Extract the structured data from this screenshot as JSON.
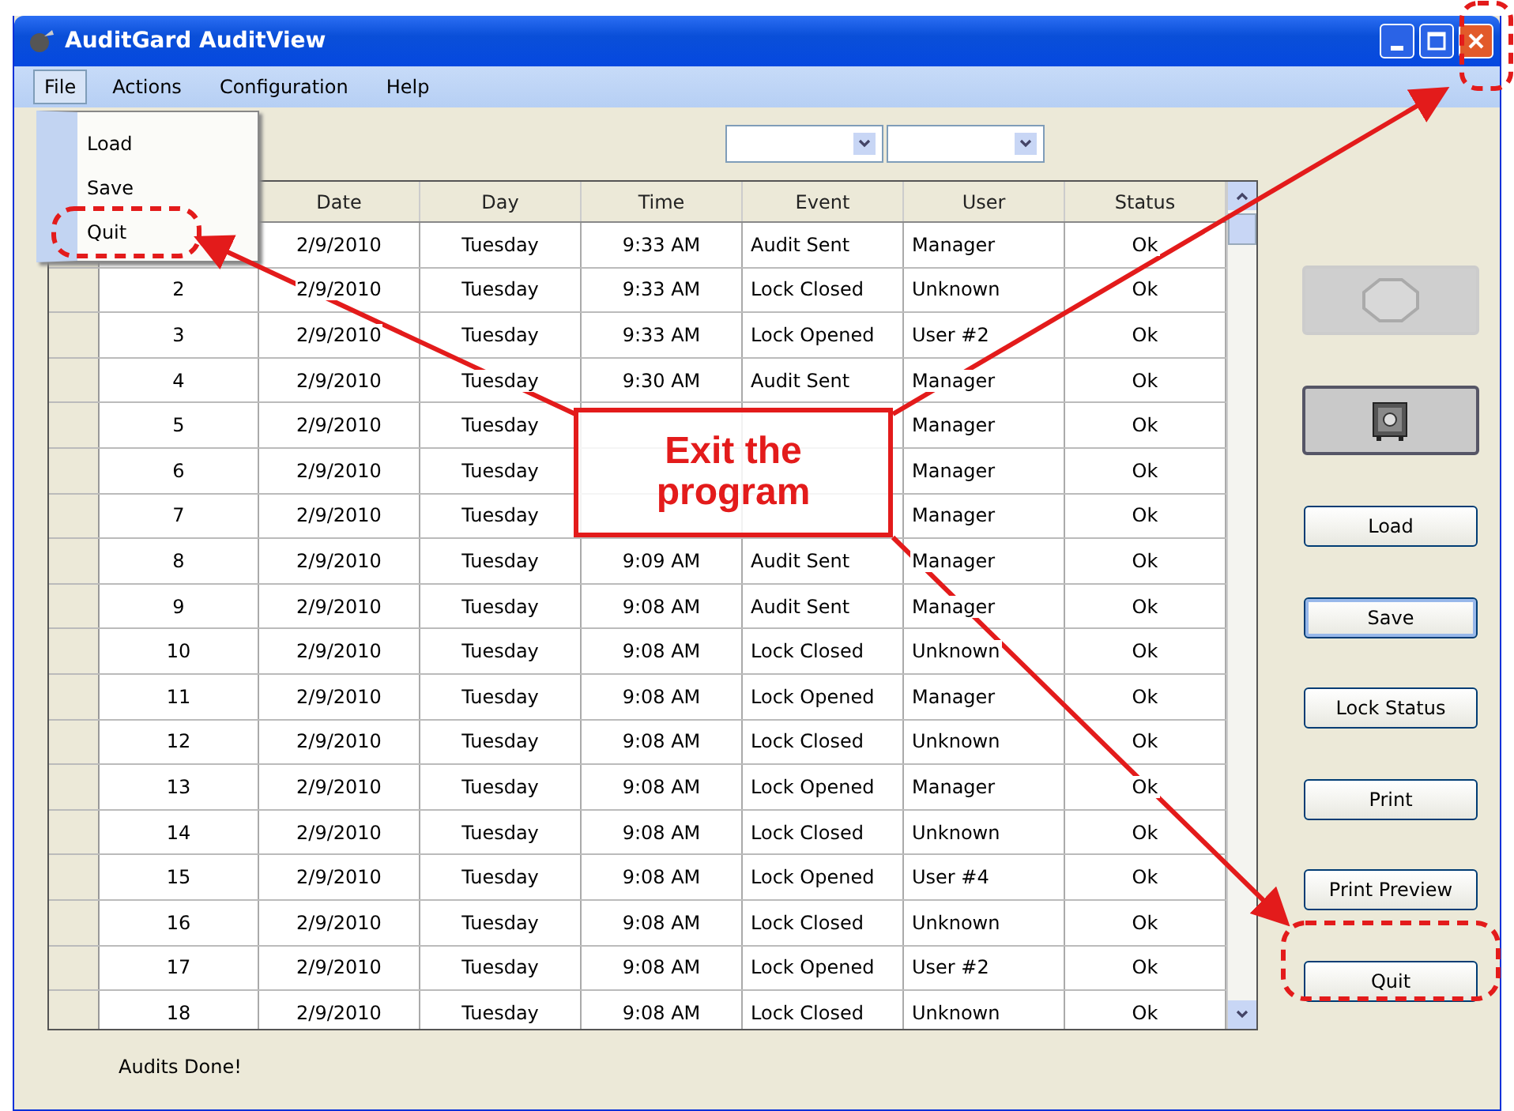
{
  "window": {
    "title": "AuditGard AuditView"
  },
  "menu": [
    {
      "label": "File",
      "selected": true
    },
    {
      "label": "Actions",
      "selected": false
    },
    {
      "label": "Configuration",
      "selected": false
    },
    {
      "label": "Help",
      "selected": false
    }
  ],
  "file_menu": [
    {
      "label": "Load"
    },
    {
      "label": "Save"
    },
    {
      "label": "Quit"
    }
  ],
  "table": {
    "columns": [
      "Date",
      "Day",
      "Time",
      "Event",
      "User",
      "Status"
    ],
    "rows": [
      {
        "date": "2/9/2010",
        "day": "Tuesday",
        "time": "9:33 AM",
        "event": "Audit Sent",
        "user": "Manager",
        "status": "Ok"
      },
      {
        "number": "2",
        "date": "2/9/2010",
        "day": "Tuesday",
        "time": "9:33 AM",
        "event": "Lock Closed",
        "user": "Unknown",
        "status": "Ok"
      },
      {
        "number": "3",
        "date": "2/9/2010",
        "day": "Tuesday",
        "time": "9:33 AM",
        "event": "Lock Opened",
        "user": "User #2",
        "status": "Ok"
      },
      {
        "number": "4",
        "date": "2/9/2010",
        "day": "Tuesday",
        "time": "9:30 AM",
        "event": "Audit Sent",
        "user": "Manager",
        "status": "Ok"
      },
      {
        "number": "5",
        "date": "2/9/2010",
        "day": "Tuesday",
        "user": "Manager",
        "status": "Ok"
      },
      {
        "number": "6",
        "date": "2/9/2010",
        "day": "Tuesday",
        "user": "Manager",
        "status": "Ok"
      },
      {
        "number": "7",
        "date": "2/9/2010",
        "day": "Tuesday",
        "user": "Manager",
        "status": "Ok"
      },
      {
        "number": "8",
        "date": "2/9/2010",
        "day": "Tuesday",
        "time": "9:09 AM",
        "event": "Audit Sent",
        "user": "Manager",
        "status": "Ok"
      },
      {
        "number": "9",
        "date": "2/9/2010",
        "day": "Tuesday",
        "time": "9:08 AM",
        "event": "Audit Sent",
        "user": "Manager",
        "status": "Ok"
      },
      {
        "number": "10",
        "date": "2/9/2010",
        "day": "Tuesday",
        "time": "9:08 AM",
        "event": "Lock Closed",
        "user": "Unknown",
        "status": "Ok"
      },
      {
        "number": "11",
        "date": "2/9/2010",
        "day": "Tuesday",
        "time": "9:08 AM",
        "event": "Lock Opened",
        "user": "Manager",
        "status": "Ok"
      },
      {
        "number": "12",
        "date": "2/9/2010",
        "day": "Tuesday",
        "time": "9:08 AM",
        "event": "Lock Closed",
        "user": "Unknown",
        "status": "Ok"
      },
      {
        "number": "13",
        "date": "2/9/2010",
        "day": "Tuesday",
        "time": "9:08 AM",
        "event": "Lock Opened",
        "user": "Manager",
        "status": "Ok"
      },
      {
        "number": "14",
        "date": "2/9/2010",
        "day": "Tuesday",
        "time": "9:08 AM",
        "event": "Lock Closed",
        "user": "Unknown",
        "status": "Ok"
      },
      {
        "number": "15",
        "date": "2/9/2010",
        "day": "Tuesday",
        "time": "9:08 AM",
        "event": "Lock Opened",
        "user": "User #4",
        "status": "Ok"
      },
      {
        "number": "16",
        "date": "2/9/2010",
        "day": "Tuesday",
        "time": "9:08 AM",
        "event": "Lock Closed",
        "user": "Unknown",
        "status": "Ok"
      },
      {
        "number": "17",
        "date": "2/9/2010",
        "day": "Tuesday",
        "time": "9:08 AM",
        "event": "Lock Opened",
        "user": "User #2",
        "status": "Ok"
      },
      {
        "number": "18",
        "date": "2/9/2010",
        "day": "Tuesday",
        "time": "9:08 AM",
        "event": "Lock Closed",
        "user": "Unknown",
        "status": "Ok"
      }
    ]
  },
  "buttons": [
    {
      "kind": "stop",
      "disabled": true
    },
    {
      "kind": "safe",
      "disabled": false
    },
    {
      "kind": "text",
      "label": "Load",
      "focused": false
    },
    {
      "kind": "text",
      "label": "Save",
      "focused": true
    },
    {
      "kind": "text",
      "label": "Lock Status",
      "focused": false
    },
    {
      "kind": "text",
      "label": "Print",
      "focused": false
    },
    {
      "kind": "text",
      "label": "Print Preview",
      "focused": false
    },
    {
      "kind": "text",
      "label": "Quit",
      "focused": false
    }
  ],
  "status_bar": "Audits Done!",
  "callout": {
    "text": "Exit the program"
  }
}
